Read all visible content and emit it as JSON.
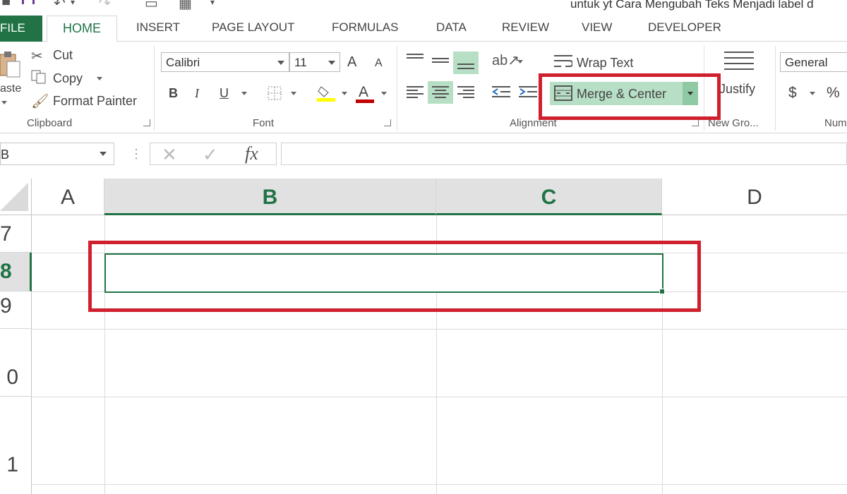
{
  "title": "untuk yt Cara Mengubah Teks Menjadi label d",
  "tabs": {
    "file": "FILE",
    "home": "HOME",
    "insert": "INSERT",
    "page_layout": "PAGE LAYOUT",
    "formulas": "FORMULAS",
    "data": "DATA",
    "review": "REVIEW",
    "view": "VIEW",
    "developer": "DEVELOPER"
  },
  "clipboard": {
    "paste": "aste",
    "cut": "Cut",
    "copy": "Copy",
    "format_painter": "Format Painter",
    "label": "Clipboard"
  },
  "font": {
    "name": "Calibri",
    "size": "11",
    "bold": "B",
    "italic": "I",
    "underline": "U",
    "grow": "A",
    "shrink": "A",
    "font_color": "A",
    "highlight_color": "#ffff00",
    "text_color": "#c00000",
    "label": "Font"
  },
  "alignment": {
    "wrap_text": "Wrap Text",
    "merge_center": "Merge & Center",
    "label": "Alignment"
  },
  "new_group": {
    "justify": "Justify",
    "label": "New Gro..."
  },
  "number": {
    "format": "General",
    "currency": "$",
    "percent": "%",
    "label": "Num"
  },
  "formula_bar": {
    "name_box": "B",
    "fx": "fx",
    "value": ""
  },
  "grid": {
    "columns": [
      "A",
      "B",
      "C",
      "D"
    ],
    "rows": [
      "7",
      "8",
      "9",
      "0",
      "1"
    ]
  },
  "colors": {
    "accent": "#217346",
    "highlight_box": "#d0202e",
    "selected_fill": "#b7dfc5"
  }
}
